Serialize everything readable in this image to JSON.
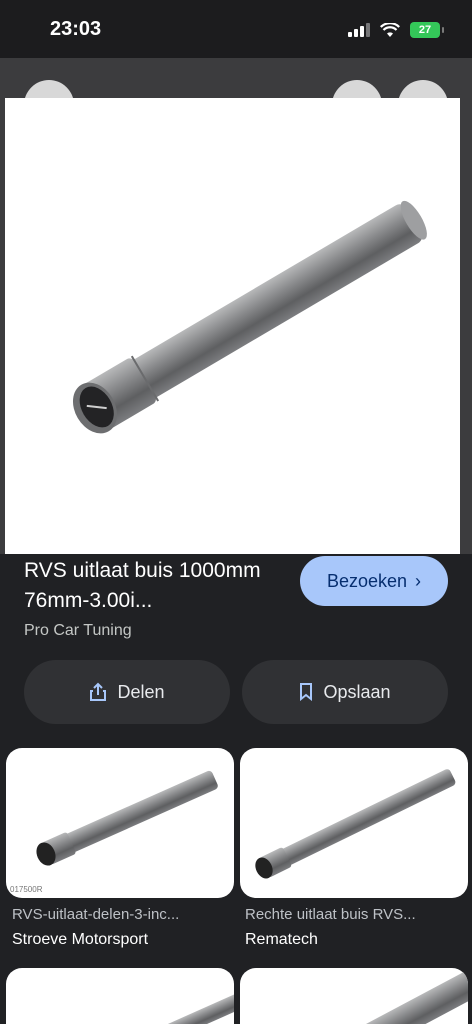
{
  "status": {
    "time": "23:03",
    "battery": "27"
  },
  "result": {
    "title": "RVS uitlaat buis 1000mm 76mm-3.00i...",
    "source": "Pro Car Tuning",
    "visit_label": "Bezoeken"
  },
  "actions": {
    "share_label": "Delen",
    "save_label": "Opslaan"
  },
  "related": [
    {
      "caption": "RVS-uitlaat-delen-3-inc...",
      "source": "Stroeve Motorsport",
      "label": "017500R"
    },
    {
      "caption": "Rechte uitlaat buis RVS...",
      "source": "Rematech"
    }
  ],
  "colors": {
    "accent": "#a8c7fa",
    "background": "#202124",
    "battery": "#34c759"
  }
}
